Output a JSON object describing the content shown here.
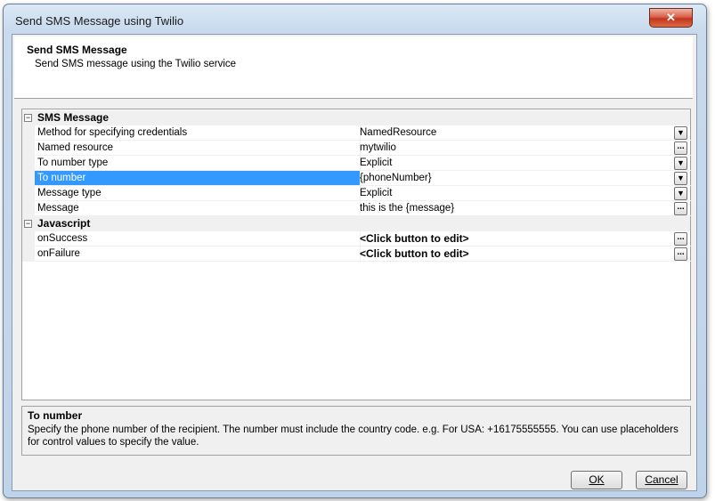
{
  "window": {
    "title": "Send SMS Message using Twilio",
    "close_glyph": "✕"
  },
  "header": {
    "title": "Send SMS Message",
    "subtitle": "Send SMS message using the Twilio service"
  },
  "property_grid": {
    "categories": [
      {
        "toggle": "−",
        "label": "SMS Message",
        "properties": [
          {
            "name": "Method for specifying credentials",
            "value": "NamedResource",
            "button": "▼",
            "button_icon": "dropdown-arrow-icon"
          },
          {
            "name": "Named resource",
            "value": "mytwilio",
            "button": "...",
            "button_icon": "ellipsis-icon"
          },
          {
            "name": "To number type",
            "value": "Explicit",
            "button": "▼",
            "button_icon": "dropdown-arrow-icon"
          },
          {
            "name": "To number",
            "value": "{phoneNumber}",
            "button": "▼",
            "button_icon": "dropdown-arrow-icon",
            "selected": true
          },
          {
            "name": "Message type",
            "value": "Explicit",
            "button": "▼",
            "button_icon": "dropdown-arrow-icon"
          },
          {
            "name": "Message",
            "value": "this is the {message}",
            "button": "...",
            "button_icon": "ellipsis-icon"
          }
        ]
      },
      {
        "toggle": "−",
        "label": "Javascript",
        "properties": [
          {
            "name": "onSuccess",
            "value": "<Click button to edit>",
            "button": "...",
            "button_icon": "ellipsis-icon"
          },
          {
            "name": "onFailure",
            "value": "<Click button to edit>",
            "button": "...",
            "button_icon": "ellipsis-icon"
          }
        ]
      }
    ]
  },
  "help": {
    "title": "To number",
    "description": "Specify the phone number of the recipient. The number must include the country code. e.g. For USA: +16175555555. You can use placeholders for control values to specify the value."
  },
  "buttons": {
    "ok_label": "OK",
    "cancel_label": "Cancel"
  },
  "colors": {
    "selection": "#3399ff",
    "close_button": "#c2351c"
  }
}
